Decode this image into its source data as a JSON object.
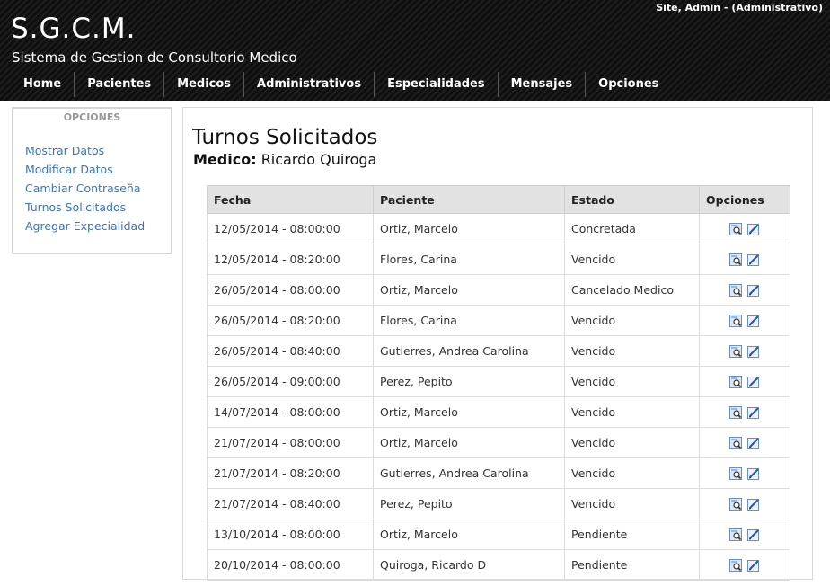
{
  "header": {
    "user_info": "Site, Admin - (Administrativo)",
    "title": "S.G.C.M.",
    "subtitle": "Sistema de Gestion de Consultorio Medico"
  },
  "nav": {
    "items": [
      "Home",
      "Pacientes",
      "Medicos",
      "Administrativos",
      "Especialidades",
      "Mensajes",
      "Opciones"
    ]
  },
  "sidebar": {
    "title": "OPCIONES",
    "items": [
      "Mostrar Datos",
      "Modificar Datos",
      "Cambiar Contraseña",
      "Turnos Solicitados",
      "Agregar Expecialidad"
    ]
  },
  "main": {
    "title": "Turnos Solicitados",
    "medico_label": "Medico:",
    "medico_name": "Ricardo Quiroga",
    "columns": [
      "Fecha",
      "Paciente",
      "Estado",
      "Opciones"
    ],
    "rows": [
      [
        "12/05/2014 - 08:00:00",
        "Ortiz, Marcelo",
        "Concretada"
      ],
      [
        "12/05/2014 - 08:20:00",
        "Flores, Carina",
        "Vencido"
      ],
      [
        "26/05/2014 - 08:00:00",
        "Ortiz, Marcelo",
        "Cancelado Medico"
      ],
      [
        "26/05/2014 - 08:20:00",
        "Flores, Carina",
        "Vencido"
      ],
      [
        "26/05/2014 - 08:40:00",
        "Gutierres, Andrea Carolina",
        "Vencido"
      ],
      [
        "26/05/2014 - 09:00:00",
        "Perez, Pepito",
        "Vencido"
      ],
      [
        "14/07/2014 - 08:00:00",
        "Ortiz, Marcelo",
        "Vencido"
      ],
      [
        "21/07/2014 - 08:00:00",
        "Ortiz, Marcelo",
        "Vencido"
      ],
      [
        "21/07/2014 - 08:20:00",
        "Gutierres, Andrea Carolina",
        "Vencido"
      ],
      [
        "21/07/2014 - 08:40:00",
        "Perez, Pepito",
        "Vencido"
      ],
      [
        "13/10/2014 - 08:00:00",
        "Ortiz, Marcelo",
        "Pendiente"
      ],
      [
        "20/10/2014 - 08:00:00",
        "Quiroga, Ricardo D",
        "Pendiente"
      ]
    ],
    "row_icons": [
      "view-icon",
      "edit-icon"
    ]
  }
}
